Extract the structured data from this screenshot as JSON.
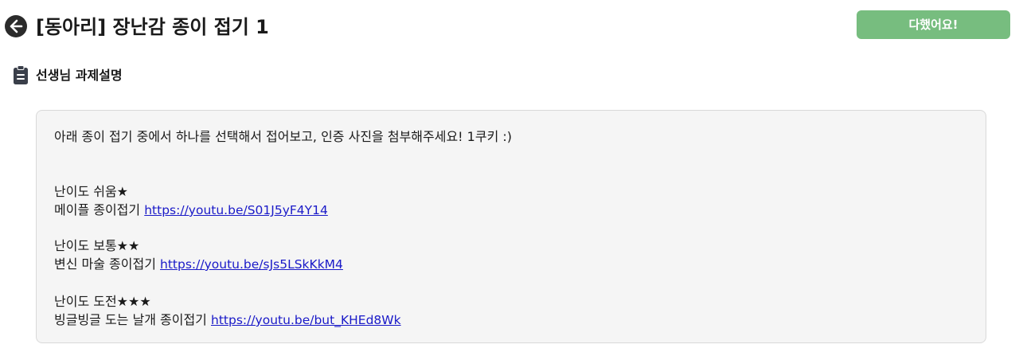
{
  "header": {
    "title": "[동아리] 장난감 종이 접기 1",
    "done_label": "다했어요!"
  },
  "section": {
    "label": "선생님 과제설명"
  },
  "assignment": {
    "intro": "아래 종이 접기 중에서 하나를 선택해서 접어보고, 인증 사진을 첨부해주세요! 1쿠키 :)",
    "levels": [
      {
        "difficulty": "난이도 쉬움★",
        "name": "메이플 종이접기",
        "link": "https://youtu.be/S01J5yF4Y14"
      },
      {
        "difficulty": "난이도 보통★★",
        "name": "변신 마술 종이접기",
        "link": "https://youtu.be/sJs5LSkKkM4"
      },
      {
        "difficulty": "난이도 도전★★★",
        "name": "빙글빙글 도는 날개 종이접기",
        "link": "https://youtu.be/but_KHEd8Wk"
      }
    ]
  },
  "colors": {
    "done_button": "#77bd7f",
    "card_background": "#f5f5f5",
    "link": "#1a1ac8"
  },
  "icons": {
    "back": "arrow-left-circle-icon",
    "section": "clipboard-icon"
  }
}
